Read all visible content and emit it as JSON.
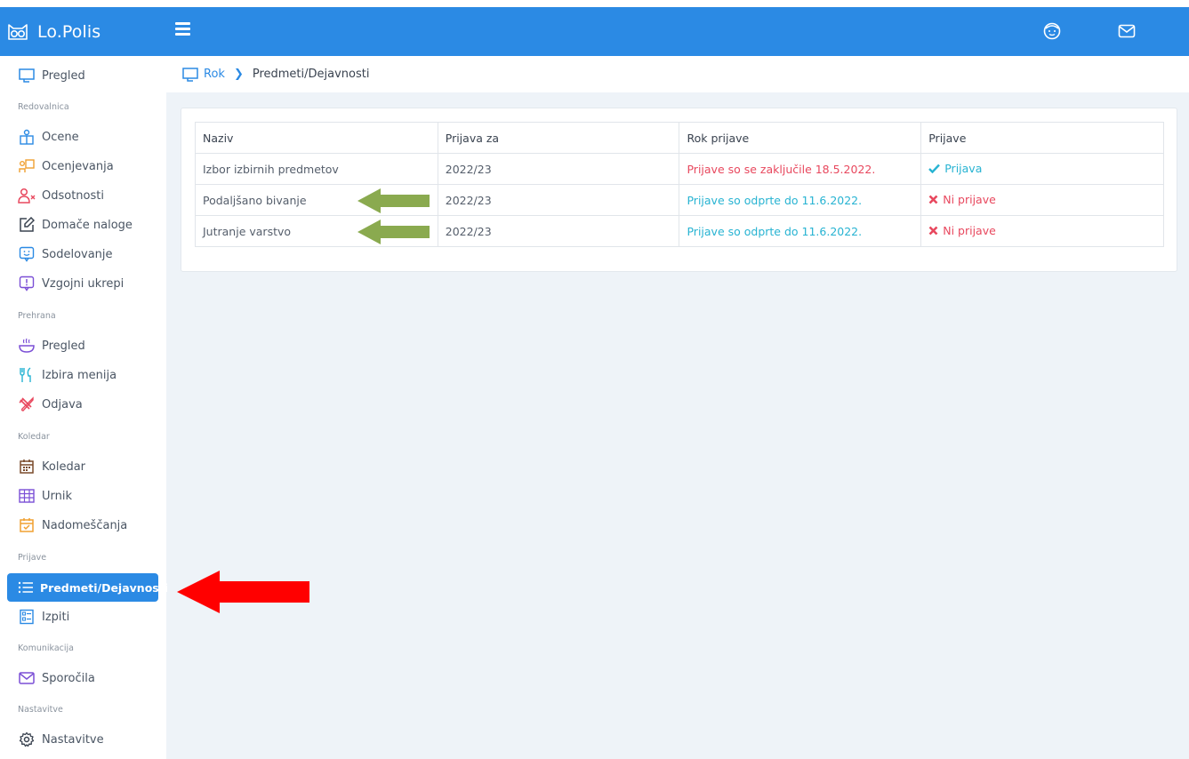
{
  "app": {
    "title": "Lo.Polis"
  },
  "breadcrumb": {
    "root": "Rok",
    "current": "Predmeti/Dejavnosti"
  },
  "sidebar": {
    "items": {
      "pregled": "Pregled",
      "ocene": "Ocene",
      "ocenjevanja": "Ocenjevanja",
      "odsotnosti": "Odsotnosti",
      "domace_naloge": "Domače naloge",
      "sodelovanje": "Sodelovanje",
      "vzgojni_ukrepi": "Vzgojni ukrepi",
      "prehrana_pregled": "Pregled",
      "izbira_menija": "Izbira menija",
      "odjava": "Odjava",
      "koledar": "Koledar",
      "urnik": "Urnik",
      "nadomescanja": "Nadomeščanja",
      "predmeti": "Predmeti/Dejavnosti",
      "izpiti": "Izpiti",
      "sporocila": "Sporočila",
      "nastavitve": "Nastavitve"
    },
    "sections": {
      "redovalnica": "Redovalnica",
      "prehrana": "Prehrana",
      "koledar": "Koledar",
      "prijave": "Prijave",
      "komunikacija": "Komunikacija",
      "nastavitve": "Nastavitve"
    },
    "active": "Predmeti/Dejavnosti"
  },
  "table": {
    "headers": [
      "Naziv",
      "Prijava za",
      "Rok prijave",
      "Prijave"
    ],
    "rows": [
      {
        "naziv": "Izbor izbirnih predmetov",
        "prijava_za": "2022/23",
        "rok": "Prijave so se zaključile 18.5.2022.",
        "status": "Prijava"
      },
      {
        "naziv": "Podaljšano bivanje",
        "prijava_za": "2022/23",
        "rok": "Prijave so odprte do 11.6.2022.",
        "status": "Ni prijave"
      },
      {
        "naziv": "Jutranje varstvo",
        "prijava_za": "2022/23",
        "rok": "Prijave so odprte do 11.6.2022.",
        "status": "Ni prijave"
      }
    ]
  },
  "icons": {
    "header": [
      "logo-owl-icon",
      "menu-icon",
      "user-face-icon",
      "mail-icon"
    ],
    "status": [
      "check-icon",
      "cross-icon"
    ]
  },
  "colors": {
    "primary": "#2b8ae4",
    "closed_text": "#e8485e",
    "open_text": "#27b3d2",
    "annotation_green": "#8aaa4f",
    "annotation_red": "#ff0000"
  }
}
